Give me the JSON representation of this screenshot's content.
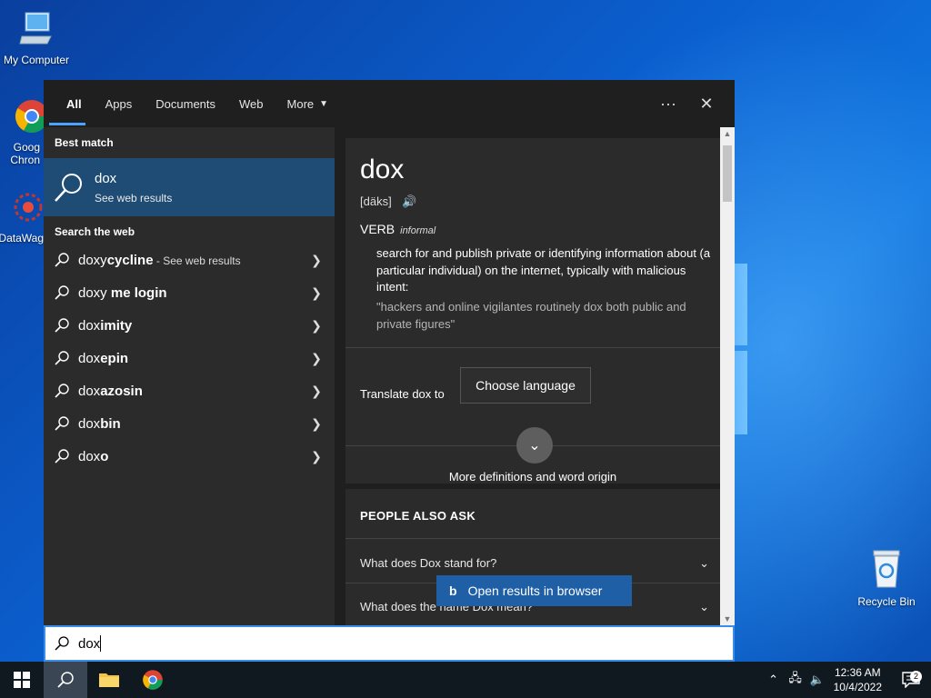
{
  "desktop": {
    "icons": [
      {
        "name": "my-computer-icon",
        "label": "My Computer"
      },
      {
        "name": "google-chrome-icon",
        "label": "Goog Chron"
      },
      {
        "name": "datawag-icon",
        "label": "DataWag"
      },
      {
        "name": "recycle-bin-icon",
        "label": "Recycle Bin"
      }
    ]
  },
  "tabs": [
    {
      "label": "All",
      "active": true
    },
    {
      "label": "Apps"
    },
    {
      "label": "Documents"
    },
    {
      "label": "Web"
    },
    {
      "label": "More"
    }
  ],
  "toolbar": {
    "more_options": "···",
    "close": "✕"
  },
  "left": {
    "best_match_heading": "Best match",
    "best_match": {
      "title": "dox",
      "subtitle": "See web results"
    },
    "search_web_heading": "Search the web",
    "suggestions": [
      {
        "prefix": "doxy",
        "bold": "cycline",
        "hint": " - See web results"
      },
      {
        "prefix": "doxy",
        "bold": " me login",
        "hint": ""
      },
      {
        "prefix": "dox",
        "bold": "imity",
        "hint": ""
      },
      {
        "prefix": "dox",
        "bold": "epin",
        "hint": ""
      },
      {
        "prefix": "dox",
        "bold": "azosin",
        "hint": ""
      },
      {
        "prefix": "dox",
        "bold": "bin",
        "hint": ""
      },
      {
        "prefix": "dox",
        "bold": "o",
        "hint": ""
      }
    ]
  },
  "definition": {
    "word": "dox",
    "pronunciation": "[däks]",
    "part_of_speech": "VERB",
    "register": "informal",
    "definition": "search for and publish private or identifying information about (a particular individual) on the internet, typically with malicious intent:",
    "example": "\"hackers and online vigilantes routinely dox both public and private figures\"",
    "translate_label": "Translate dox to",
    "choose_language": "Choose language",
    "more_definitions": "More definitions and word origin"
  },
  "people_also_ask": {
    "heading": "PEOPLE ALSO ASK",
    "questions": [
      "What does Dox stand for?",
      "What does the name Dox mean?"
    ]
  },
  "open_in_browser": "Open results in browser",
  "search": {
    "value": "dox"
  },
  "taskbar": {
    "time": "12:36 AM",
    "date": "10/4/2022",
    "notifications": "2"
  }
}
